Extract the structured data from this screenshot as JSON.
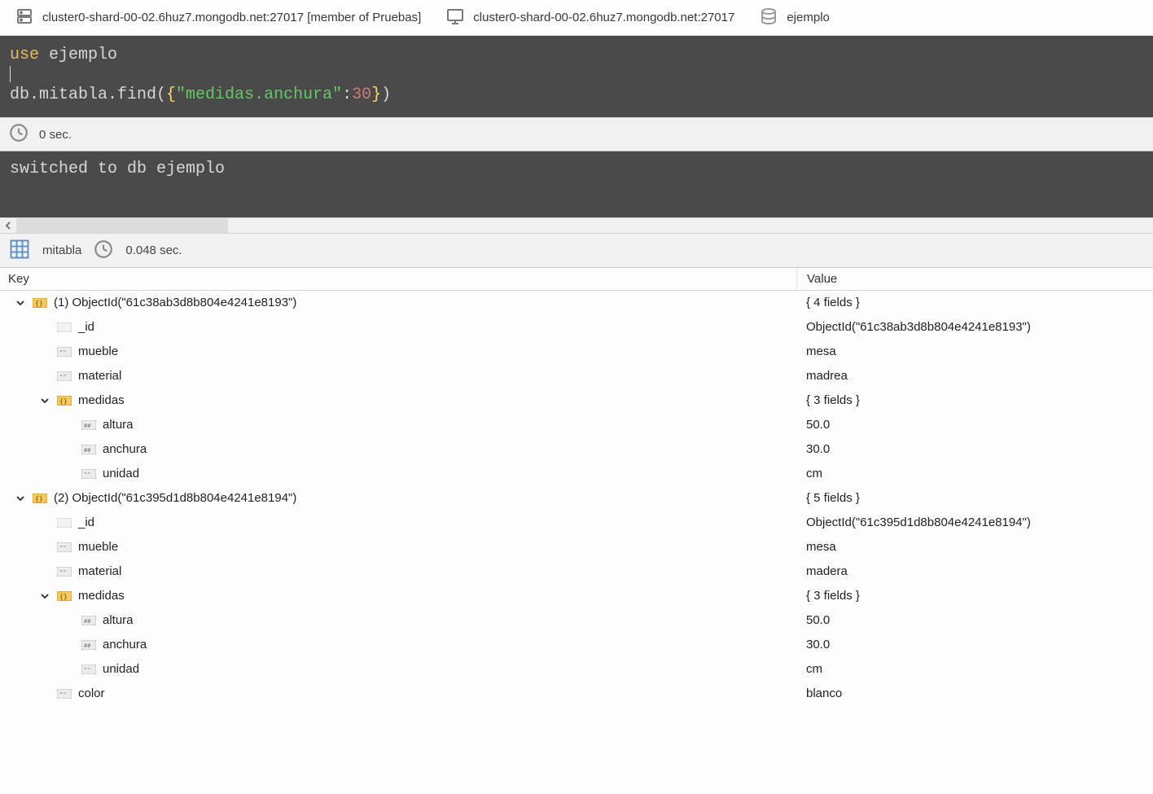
{
  "tabs": [
    {
      "label": "cluster0-shard-00-02.6huz7.mongodb.net:27017 [member of Pruebas]",
      "icon": "server"
    },
    {
      "label": "cluster0-shard-00-02.6huz7.mongodb.net:27017",
      "icon": "monitor"
    },
    {
      "label": "ejemplo",
      "icon": "database"
    }
  ],
  "editor": {
    "use_kw": "use",
    "use_db": "ejemplo",
    "find_prefix": "db.mitabla.find(",
    "find_key": "\"medidas.anchura\"",
    "find_colon": ":",
    "find_val": "30",
    "find_brace_open": "{",
    "find_brace_close": "}",
    "find_paren_close": ")"
  },
  "status1": {
    "time": "0 sec."
  },
  "output_switch": "switched to db ejemplo",
  "result_header": {
    "collection": "mitabla",
    "time": "0.048 sec."
  },
  "columns": {
    "key": "Key",
    "value": "Value"
  },
  "tree": [
    {
      "indent": 0,
      "chevron": true,
      "icon": "obj",
      "key": "(1) ObjectId(\"61c38ab3d8b804e4241e8193\")",
      "value": "{ 4 fields }"
    },
    {
      "indent": 1,
      "chevron": false,
      "icon": "blank",
      "key": "_id",
      "value": "ObjectId(\"61c38ab3d8b804e4241e8193\")"
    },
    {
      "indent": 1,
      "chevron": false,
      "icon": "str",
      "key": "mueble",
      "value": "mesa"
    },
    {
      "indent": 1,
      "chevron": false,
      "icon": "str",
      "key": "material",
      "value": "madrea"
    },
    {
      "indent": 1,
      "chevron": true,
      "icon": "obj",
      "key": "medidas",
      "value": "{ 3 fields }"
    },
    {
      "indent": 2,
      "chevron": false,
      "icon": "num",
      "key": "altura",
      "value": "50.0"
    },
    {
      "indent": 2,
      "chevron": false,
      "icon": "num",
      "key": "anchura",
      "value": "30.0"
    },
    {
      "indent": 2,
      "chevron": false,
      "icon": "str",
      "key": "unidad",
      "value": "cm"
    },
    {
      "indent": 0,
      "chevron": true,
      "icon": "obj",
      "key": "(2) ObjectId(\"61c395d1d8b804e4241e8194\")",
      "value": "{ 5 fields }"
    },
    {
      "indent": 1,
      "chevron": false,
      "icon": "blank",
      "key": "_id",
      "value": "ObjectId(\"61c395d1d8b804e4241e8194\")"
    },
    {
      "indent": 1,
      "chevron": false,
      "icon": "str",
      "key": "mueble",
      "value": "mesa"
    },
    {
      "indent": 1,
      "chevron": false,
      "icon": "str",
      "key": "material",
      "value": "madera"
    },
    {
      "indent": 1,
      "chevron": true,
      "icon": "obj",
      "key": "medidas",
      "value": "{ 3 fields }"
    },
    {
      "indent": 2,
      "chevron": false,
      "icon": "num",
      "key": "altura",
      "value": "50.0"
    },
    {
      "indent": 2,
      "chevron": false,
      "icon": "num",
      "key": "anchura",
      "value": "30.0"
    },
    {
      "indent": 2,
      "chevron": false,
      "icon": "str",
      "key": "unidad",
      "value": "cm"
    },
    {
      "indent": 1,
      "chevron": false,
      "icon": "str",
      "key": "color",
      "value": "blanco"
    }
  ]
}
